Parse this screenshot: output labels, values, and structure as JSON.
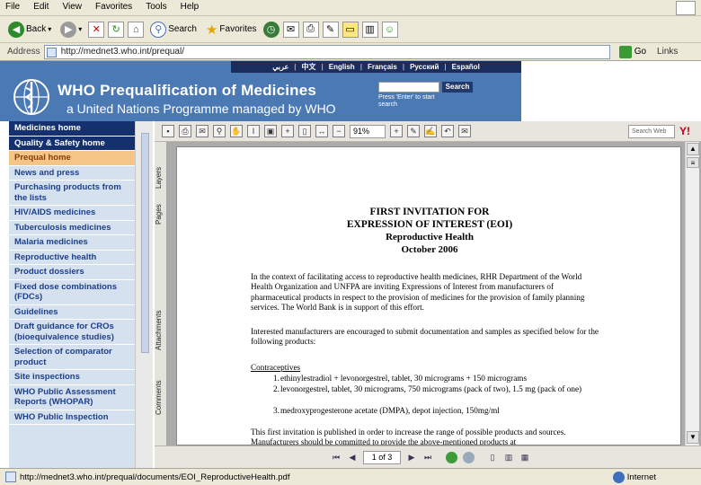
{
  "browser": {
    "menu": [
      "File",
      "Edit",
      "View",
      "Favorites",
      "Tools",
      "Help"
    ],
    "toolbar": {
      "back_label": "Back",
      "search_label": "Search",
      "favorites_label": "Favorites"
    },
    "address_label": "Address",
    "address_url": "http://mednet3.who.int/prequal/",
    "go_label": "Go",
    "links_label": "Links"
  },
  "header": {
    "languages": [
      "عربي",
      "中文",
      "English",
      "Français",
      "Русский",
      "Español"
    ],
    "title": "WHO Prequalification of Medicines",
    "subtitle": "a United Nations Programme managed by WHO",
    "search_button": "Search",
    "search_help": "Press 'Enter' to start search"
  },
  "sidebar": {
    "items": [
      {
        "label": "Medicines home",
        "style": "dark"
      },
      {
        "label": "Quality & Safety home",
        "style": "dark"
      },
      {
        "label": "Prequal home",
        "style": "hl"
      },
      {
        "label": "News and press",
        "style": ""
      },
      {
        "label": "Purchasing products from the lists",
        "style": ""
      },
      {
        "label": "HIV/AIDS medicines",
        "style": ""
      },
      {
        "label": "Tuberculosis medicines",
        "style": ""
      },
      {
        "label": "Malaria medicines",
        "style": ""
      },
      {
        "label": "Reproductive health",
        "style": ""
      },
      {
        "label": "Product dossiers",
        "style": ""
      },
      {
        "label": "Fixed dose combinations (FDCs)",
        "style": ""
      },
      {
        "label": "Guidelines",
        "style": ""
      },
      {
        "label": "Draft guidance for CROs (bioequivalence studies)",
        "style": ""
      },
      {
        "label": "Selection of comparator product",
        "style": ""
      },
      {
        "label": "Site inspections",
        "style": ""
      },
      {
        "label": "WHO Public Assessment Reports (WHOPAR)",
        "style": ""
      },
      {
        "label": "WHO Public Inspection",
        "style": ""
      }
    ]
  },
  "pdf": {
    "zoom": "91%",
    "search_web": "Search Web",
    "side_tabs": {
      "layers": "Layers",
      "pages": "Pages",
      "attachments": "Attachments",
      "comments": "Comments"
    },
    "page_indicator": "1 of 3",
    "doc": {
      "title1": "FIRST INVITATION FOR",
      "title2": "EXPRESSION OF INTEREST (EOI)",
      "title3": "Reproductive Health",
      "title4": "October 2006",
      "p1": "In the context of facilitating access to reproductive health medicines, RHR Department of the World Health Organization and UNFPA are inviting Expressions of Interest from manufacturers of pharmaceutical products in respect to the provision of medicines for the provision of family planning services. The World Bank is in support of this effort.",
      "p2": "Interested manufacturers are encouraged to submit documentation and samples as specified below for the following products:",
      "section": "Contraceptives",
      "list": [
        "ethinylestradiol + levonorgestrel, tablet, 30 micrograms + 150 micrograms",
        "levonorgestrel, tablet, 30 micrograms, 750 micrograms (pack of two), 1.5 mg (pack of one)",
        "medroxyprogesterone acetate (DMPA), depot injection, 150mg/ml"
      ],
      "p3": "This first invitation is published in order to increase the range of possible products and sources. Manufacturers should be committed to provide the above-mentioned products at"
    }
  },
  "status": {
    "text": "http://mednet3.who.int/prequal/documents/EOI_ReproductiveHealth.pdf",
    "zone": "Internet"
  }
}
